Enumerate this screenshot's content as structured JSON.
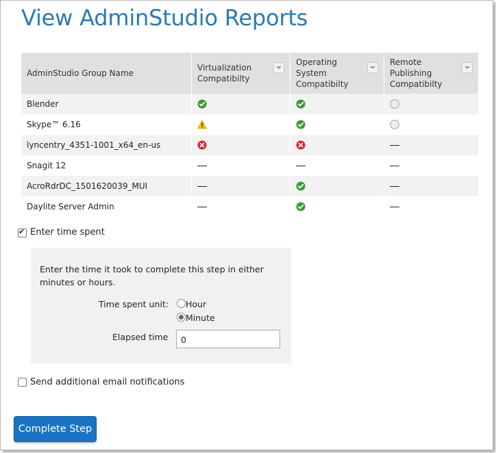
{
  "title": "View AdminStudio Reports",
  "table": {
    "columns": [
      {
        "label": "AdminStudio Group Name",
        "filter": false
      },
      {
        "label": "Virtualization Compatibilty",
        "filter": true
      },
      {
        "label": "Operating System Compatibilty",
        "filter": true
      },
      {
        "label": "Remote Publishing Compatibilty",
        "filter": true
      }
    ],
    "rows": [
      {
        "name": "Blender",
        "virtualization": "ok",
        "os": "ok",
        "remote": "neutral"
      },
      {
        "name": "Skype™ 6.16",
        "virtualization": "warning",
        "os": "ok",
        "remote": "neutral"
      },
      {
        "name": "lyncentry_4351-1001_x64_en-us",
        "virtualization": "error",
        "os": "error",
        "remote": "none"
      },
      {
        "name": "Snagit 12",
        "virtualization": "none",
        "os": "none",
        "remote": "none"
      },
      {
        "name": "AcroRdrDC_1501620039_MUI",
        "virtualization": "none",
        "os": "ok",
        "remote": "none"
      },
      {
        "name": "Daylite Server Admin",
        "virtualization": "none",
        "os": "ok",
        "remote": "none"
      }
    ]
  },
  "time_spent": {
    "checkbox_label": "Enter time spent",
    "checked": true,
    "instructions": "Enter the time it took to complete this step in either minutes or hours.",
    "unit_label": "Time spent unit:",
    "unit_options": [
      "Hour",
      "Minute"
    ],
    "selected_unit": "Minute",
    "elapsed_label": "Elapsed time",
    "elapsed_value": "0"
  },
  "email": {
    "checkbox_label": "Send additional email notifications",
    "checked": false
  },
  "complete_button": "Complete Step",
  "colors": {
    "title": "#2a7ab0",
    "button": "#1a73c4",
    "ok": "#3d9a35",
    "warning": "#f2c200",
    "error": "#d9272e"
  }
}
